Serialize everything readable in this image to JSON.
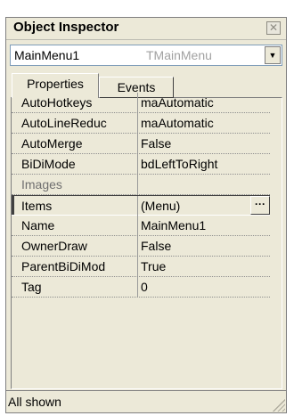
{
  "window": {
    "title": "Object Inspector",
    "close_glyph": "✕"
  },
  "component_selector": {
    "name": "MainMenu1",
    "type": "TMainMenu",
    "dropdown_glyph": "▼"
  },
  "tabs": [
    {
      "label": "Properties",
      "active": true
    },
    {
      "label": "Events",
      "active": false
    }
  ],
  "properties": [
    {
      "name": "AutoHotkeys",
      "value": "maAutomatic"
    },
    {
      "name": "AutoLineReduc",
      "value": "maAutomatic"
    },
    {
      "name": "AutoMerge",
      "value": "False"
    },
    {
      "name": "BiDiMode",
      "value": "bdLeftToRight"
    },
    {
      "name": "Images",
      "value": ""
    },
    {
      "name": "Items",
      "value": "(Menu)",
      "selected": true,
      "ellipsis": "···"
    },
    {
      "name": "Name",
      "value": "MainMenu1"
    },
    {
      "name": "OwnerDraw",
      "value": "False"
    },
    {
      "name": "ParentBiDiMod",
      "value": "True"
    },
    {
      "name": "Tag",
      "value": "0"
    }
  ],
  "status": {
    "text": "All shown"
  }
}
